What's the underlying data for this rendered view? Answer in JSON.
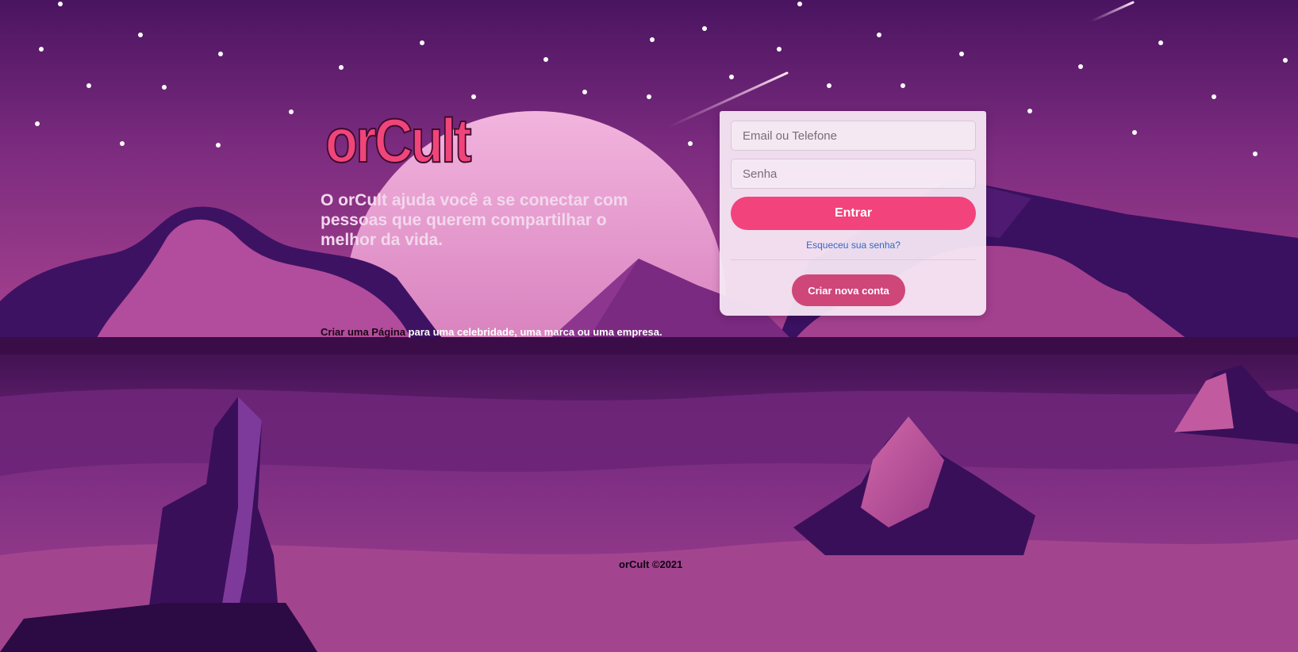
{
  "brand": {
    "logo_text": "orCult",
    "tagline": "O orCult ajuda você a se conectar com pessoas que querem compartilhar o melhor da vida."
  },
  "login": {
    "email_placeholder": "Email ou Telefone",
    "password_placeholder": "Senha",
    "submit_label": "Entrar",
    "forgot_label": "Esqueceu sua senha?",
    "create_label": "Criar nova conta"
  },
  "create_page": {
    "link_text": "Criar uma Página",
    "rest_text": " para uma celebridade, uma marca ou uma empresa."
  },
  "footer": {
    "text": "orCult ©2021"
  },
  "colors": {
    "accent": "#f2437c",
    "create_button": "#cf4679",
    "logo": "#f0457a",
    "link": "#3566c9",
    "sky_top": "#4a1460",
    "sky_bottom": "#9c3a8c"
  },
  "icons": {
    "background": "purple-night-landscape-illustration"
  }
}
